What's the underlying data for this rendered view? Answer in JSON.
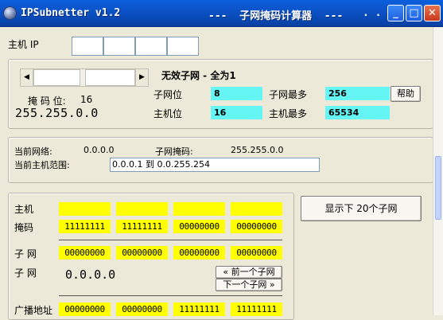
{
  "window": {
    "title_left": "IPSubnetter v1.2",
    "title_right": "---  子网掩码计算器  ---",
    "title_dots": ". . .",
    "min_glyph": "_",
    "max_glyph": "□",
    "close_glyph": "✕"
  },
  "ip_section": {
    "label": "主机 IP",
    "octets": [
      "",
      "",
      "",
      ""
    ]
  },
  "mask_section": {
    "slider_left_arrow": "◀",
    "slider_right_arrow": "▶",
    "mask_bits_label": "掩 码 位:",
    "mask_bits_value": "16",
    "mask_value": "255.255.0.0",
    "status": "无效子网 - 全为1",
    "subnet_bits_label": "子网位",
    "subnet_bits_value": "8",
    "max_subnets_label": "子网最多",
    "max_subnets_value": "256",
    "host_bits_label": "主机位",
    "host_bits_value": "16",
    "max_hosts_label": "主机最多",
    "max_hosts_value": "65534",
    "help_button": "帮助"
  },
  "network_section": {
    "current_network_label": "当前网络:",
    "current_network_value": "0.0.0.0",
    "subnet_mask_label": "子网掩码:",
    "subnet_mask_value": "255.255.0.0",
    "host_range_label": "当前主机范围:",
    "host_range_value": "0.0.0.1 到 0.0.255.254"
  },
  "binary_section": {
    "host_label": "主机",
    "host_octets": [
      "",
      "",
      "",
      ""
    ],
    "mask_label": "掩码",
    "mask_octets": [
      "11111111",
      "11111111",
      "00000000",
      "00000000"
    ],
    "subnet_label": "子 网",
    "subnet_octets": [
      "00000000",
      "00000000",
      "00000000",
      "00000000"
    ],
    "subnet2_label": "子 网",
    "subnet_value": "0.0.0.0",
    "prev_button": "« 前一个子网",
    "next_button": "下一个子网 »",
    "broadcast_label": "广播地址",
    "broadcast_octets": [
      "00000000",
      "00000000",
      "11111111",
      "11111111"
    ]
  },
  "show_next_button": "显示下 20个子网",
  "colors": {
    "titlebar": "#0c53c8",
    "highlight_yellow": "#ffff00",
    "highlight_cyan": "#66f5f5",
    "window_bg": "#ece9d8"
  }
}
